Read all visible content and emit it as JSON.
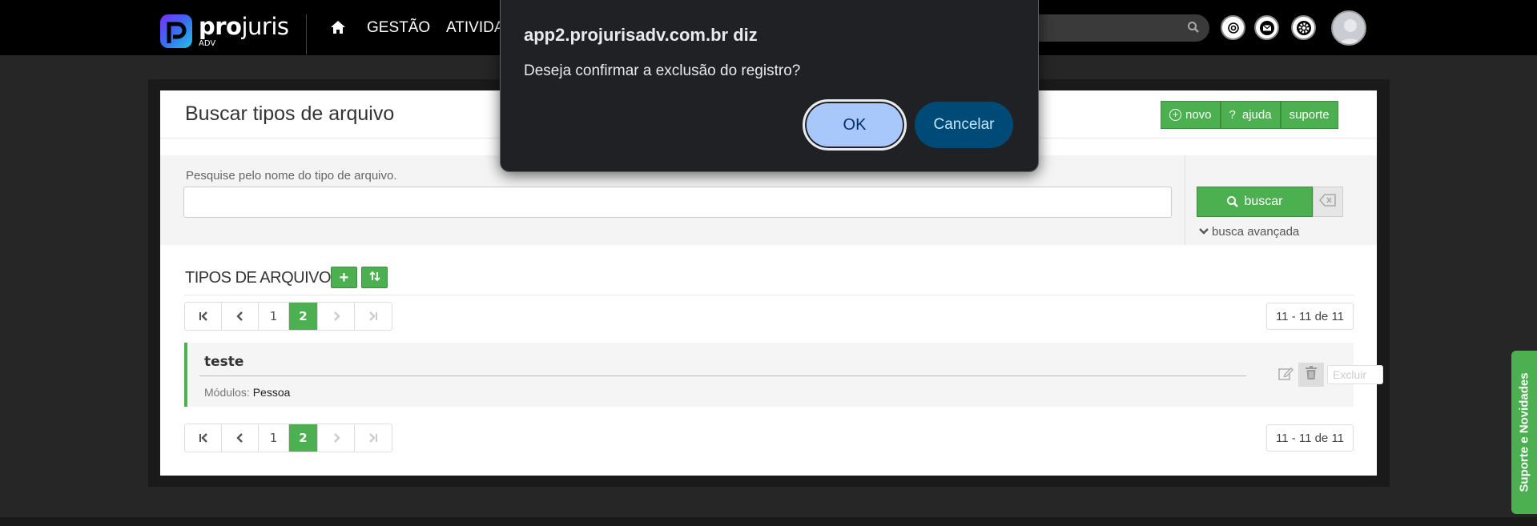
{
  "brand": {
    "name_bold": "pro",
    "name_light": "juris",
    "sub": "ADV",
    "accent": "#4caf50"
  },
  "nav": {
    "items": [
      "GESTÃO",
      "ATIVIDA"
    ]
  },
  "page": {
    "title": "Buscar tipos de arquivo",
    "actions": {
      "novo": "novo",
      "ajuda": "ajuda",
      "suporte": "suporte"
    }
  },
  "search": {
    "label": "Pesquise pelo nome do tipo de arquivo.",
    "value": "",
    "button": "buscar",
    "advanced": "busca avançada"
  },
  "list": {
    "title": "TIPOS DE ARQUIVO",
    "pager": {
      "current": "1",
      "active": "2"
    },
    "count": "11 - 11 de 11",
    "records": [
      {
        "title": "teste",
        "modules_label": "Módulos:",
        "modules_value": "Pessoa",
        "tooltip": "Excluir"
      }
    ]
  },
  "side_tab": "Suporte e Novidades",
  "dialog": {
    "title": "app2.projurisadv.com.br diz",
    "message": "Deseja confirmar a exclusão do registro?",
    "ok": "OK",
    "cancel": "Cancelar"
  }
}
